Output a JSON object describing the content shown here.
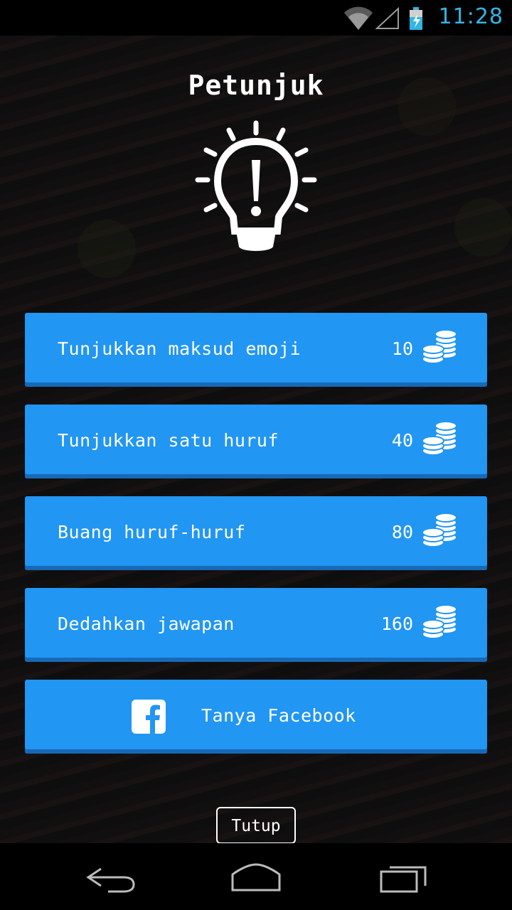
{
  "status_bar": {
    "time": "11:28",
    "icons": [
      "wifi-icon",
      "signal-icon",
      "battery-charging-icon"
    ]
  },
  "dialog": {
    "title": "Petunjuk",
    "header_icon": "lightbulb-exclamation-icon",
    "hints": [
      {
        "label": "Tunjukkan maksud emoji",
        "cost": "10",
        "icon": "coins-icon"
      },
      {
        "label": "Tunjukkan satu huruf",
        "cost": "40",
        "icon": "coins-icon"
      },
      {
        "label": "Buang huruf-huruf",
        "cost": "80",
        "icon": "coins-icon"
      },
      {
        "label": "Dedahkan jawapan",
        "cost": "160",
        "icon": "coins-icon"
      }
    ],
    "facebook": {
      "label": "Tanya Facebook",
      "icon": "facebook-icon"
    },
    "close_label": "Tutup"
  },
  "nav_bar": {
    "icons": [
      "back-icon",
      "home-icon",
      "recent-apps-icon"
    ]
  },
  "colors": {
    "button": "#2196f3",
    "button_shadow": "#1769b8",
    "status_accent": "#33b5e5"
  }
}
